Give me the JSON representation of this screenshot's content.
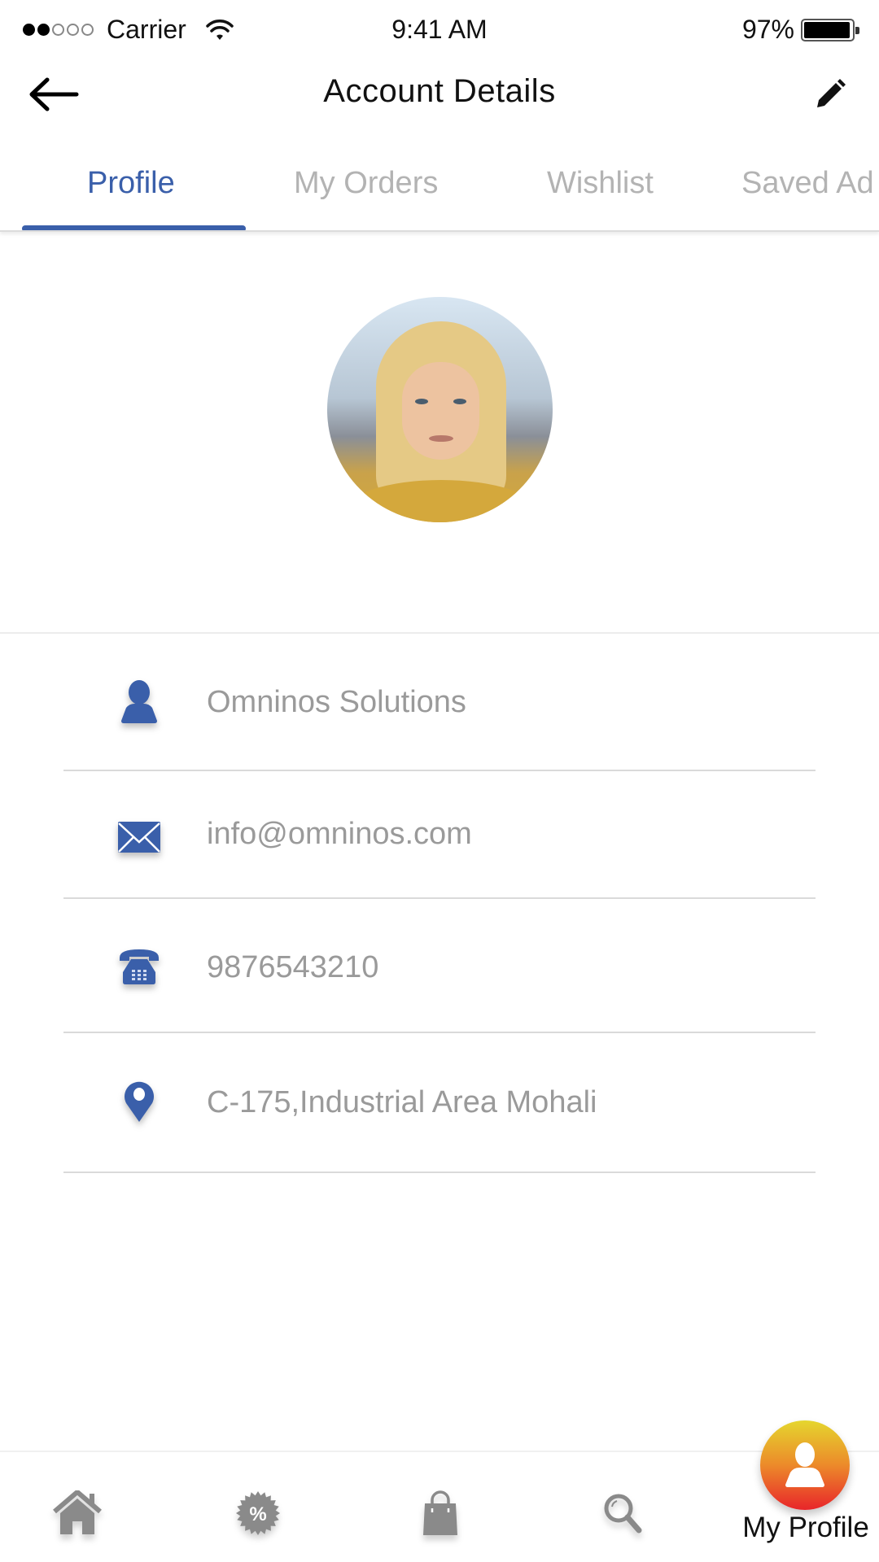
{
  "status_bar": {
    "signal_strength": "2 of 5",
    "carrier": "Carrier",
    "time": "9:41 AM",
    "battery_percent": "97%",
    "battery_level": 0.97
  },
  "nav": {
    "back_icon": "arrow-left-icon",
    "title": "Account Details",
    "edit_icon": "pencil-icon"
  },
  "tabs": [
    {
      "label": "Profile",
      "active": true
    },
    {
      "label": "My Orders",
      "active": false
    },
    {
      "label": "Wishlist",
      "active": false
    },
    {
      "label": "Saved Ad",
      "active": false
    }
  ],
  "profile": {
    "avatar": "profile-photo",
    "fields": [
      {
        "icon": "person-icon",
        "value": "Omninos Solutions"
      },
      {
        "icon": "envelope-icon",
        "value": "info@omninos.com"
      },
      {
        "icon": "telephone-icon",
        "value": "9876543210"
      },
      {
        "icon": "location-pin-icon",
        "value": "C-175,Industrial Area Mohali"
      }
    ]
  },
  "colors": {
    "accent": "#3a5faa",
    "inactive_tab": "#b3b3b3",
    "field_text": "#9a9a9a",
    "nav_icon": "#8a8a8a",
    "fab_gradient_top": "#e5d62e",
    "fab_gradient_bottom": "#e8252a"
  },
  "bottom_nav": {
    "items": [
      {
        "icon": "home-icon",
        "label": ""
      },
      {
        "icon": "discount-badge-icon",
        "label": ""
      },
      {
        "icon": "shopping-bag-icon",
        "label": ""
      },
      {
        "icon": "search-icon",
        "label": ""
      }
    ],
    "active": {
      "icon": "profile-icon",
      "label": "My Profile"
    }
  }
}
